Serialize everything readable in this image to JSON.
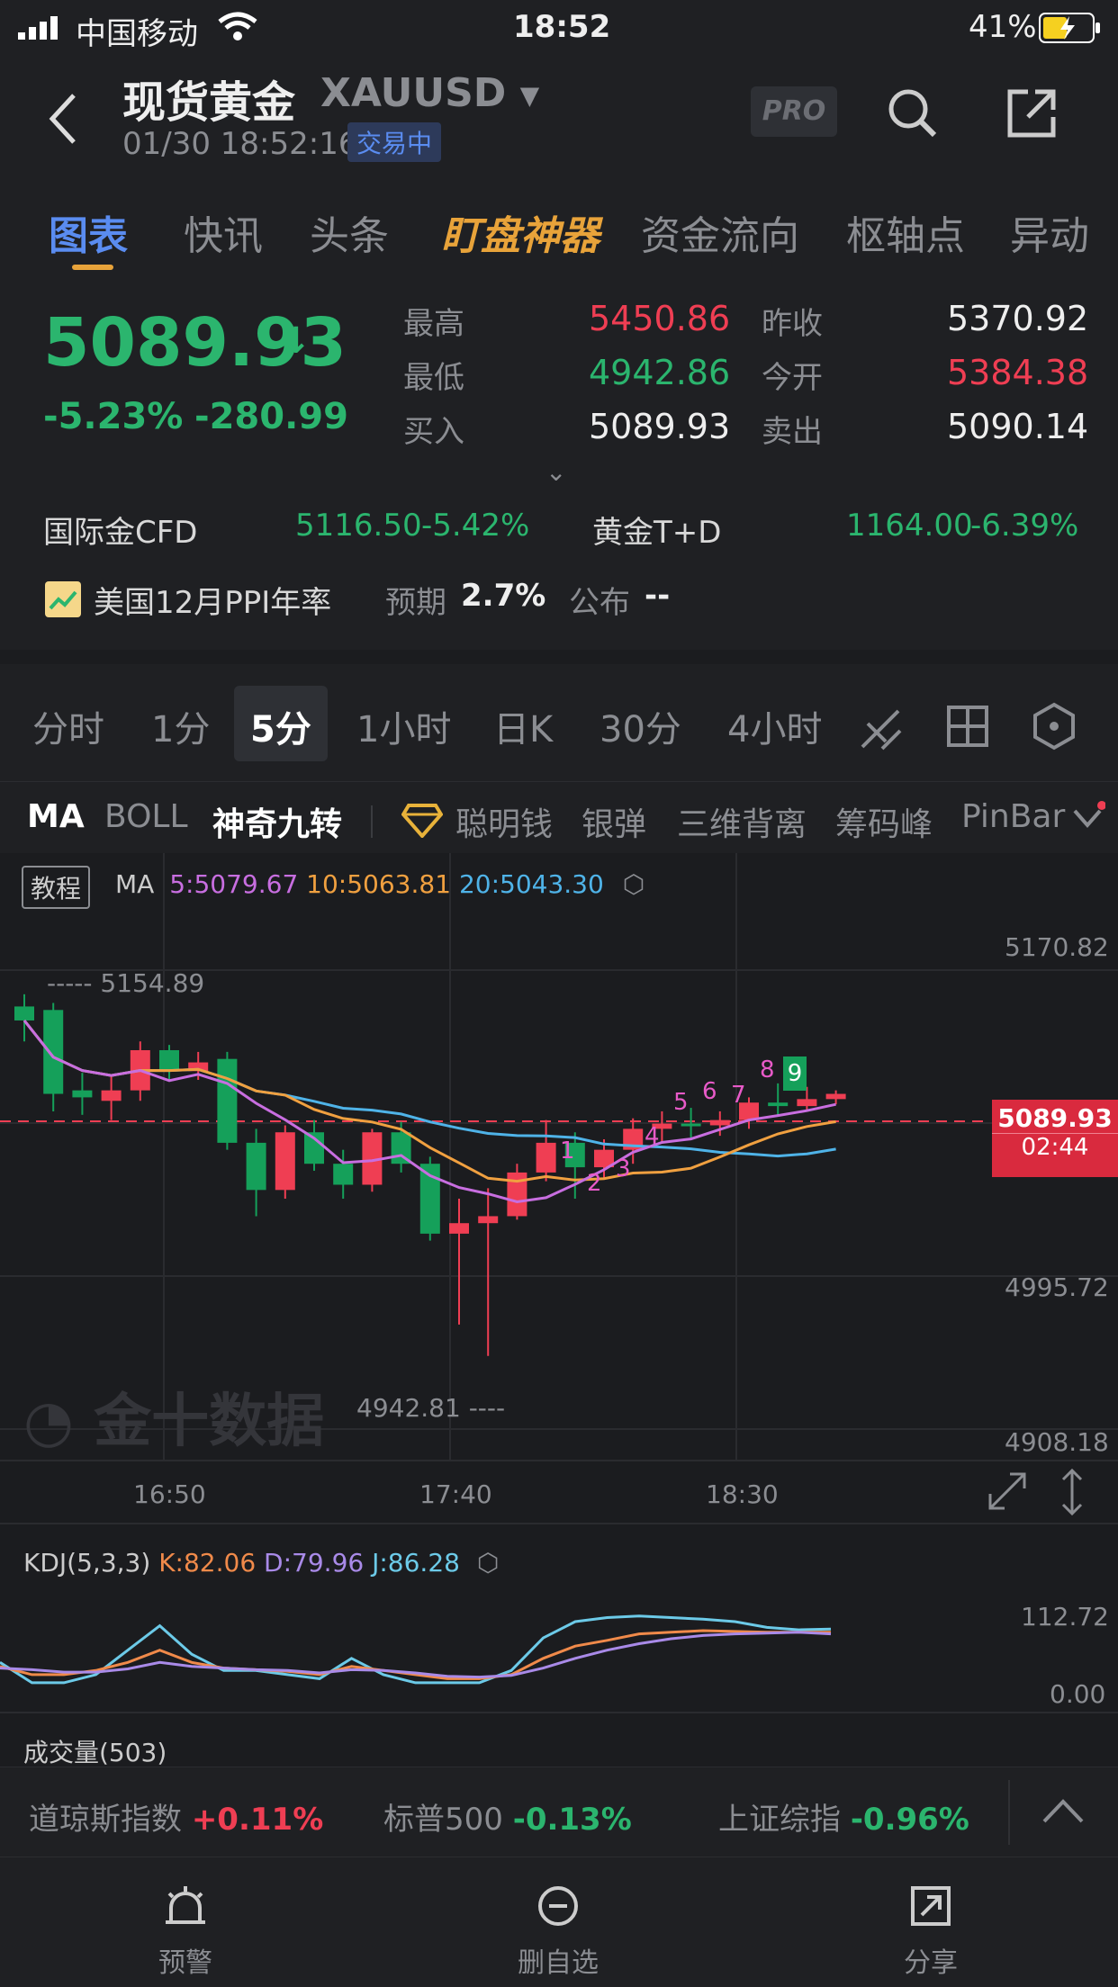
{
  "status_bar": {
    "carrier": "中国移动",
    "time": "18:52",
    "battery": "41%"
  },
  "header": {
    "title": "现货黄金",
    "symbol": "XAUUSD",
    "datetime": "01/30 18:52:16",
    "status": "交易中",
    "pro_label": "PRO"
  },
  "tabs": [
    "图表",
    "快讯",
    "头条",
    "盯盘神器",
    "资金流向",
    "枢轴点",
    "异动"
  ],
  "quote": {
    "price": "5089.93",
    "change_pct": "-5.23%",
    "change": "-280.99",
    "high_label": "最高",
    "high": "5450.86",
    "low_label": "最低",
    "low": "4942.86",
    "bid_label": "买入",
    "bid": "5089.93",
    "prev_close_label": "昨收",
    "prev_close": "5370.92",
    "open_label": "今开",
    "open": "5384.38",
    "ask_label": "卖出",
    "ask": "5090.14"
  },
  "related": [
    {
      "name": "国际金CFD",
      "price": "5116.50",
      "pct": "-5.42%"
    },
    {
      "name": "黄金T+D",
      "price": "1164.00",
      "pct": "-6.39%"
    }
  ],
  "event": {
    "title": "美国12月PPI年率",
    "expected_label": "预期",
    "expected": "2.7%",
    "published_label": "公布",
    "published": "--"
  },
  "periods": [
    "分时",
    "1分",
    "5分",
    "1小时",
    "日K",
    "30分",
    "4小时"
  ],
  "indicators": [
    "MA",
    "BOLL",
    "神奇九转",
    "聪明钱",
    "银弹",
    "三维背离",
    "筹码峰",
    "PinBar"
  ],
  "chart": {
    "tutorial": "教程",
    "ma_label": "MA",
    "ma5": "5:5079.67",
    "ma10": "10:5063.81",
    "ma20": "20:5043.30",
    "y_top": "5170.82",
    "y_mid": "4995.72",
    "y_bottom": "4908.18",
    "current_price": "5089.93",
    "countdown": "02:44",
    "high_mark": "5154.89",
    "low_mark": "4942.81",
    "watermark": "金十数据",
    "x_ticks": [
      "16:50",
      "17:40",
      "18:30"
    ],
    "nine_count": [
      "1",
      "2",
      "3",
      "4",
      "5",
      "6",
      "8",
      "9"
    ]
  },
  "kdj": {
    "label": "KDJ(5,3,3)",
    "k": "K:82.06",
    "d": "D:79.96",
    "j": "J:86.28",
    "y_top": "112.72",
    "y_bottom": "0.00"
  },
  "volume": {
    "label": "成交量(503)"
  },
  "ticker": [
    {
      "name": "道琼斯指数",
      "pct": "+0.11%"
    },
    {
      "name": "标普500",
      "pct": "-0.13%"
    },
    {
      "name": "上证综指",
      "pct": "-0.96%"
    }
  ],
  "bottom_nav": [
    "预警",
    "删自选",
    "分享"
  ],
  "colors": {
    "up": "#ef3e53",
    "down": "#2bb56e",
    "accent": "#5a8cf0",
    "ma5": "#c86ee0",
    "ma10": "#f0a040",
    "ma20": "#4fb3e8"
  }
}
